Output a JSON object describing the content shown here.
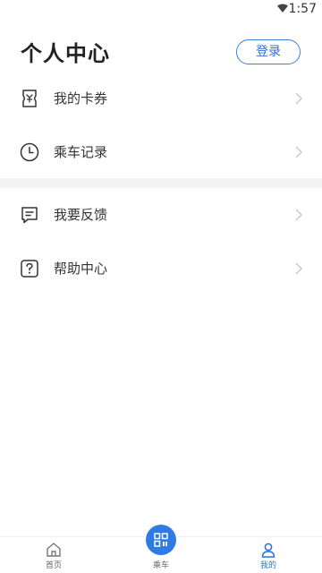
{
  "status_bar": {
    "time": "1:57",
    "wifi_icon": "wifi-icon"
  },
  "header": {
    "title": "个人中心",
    "login_label": "登录"
  },
  "menu": {
    "items": [
      {
        "label": "我的卡券",
        "icon": "ticket-icon"
      },
      {
        "label": "乘车记录",
        "icon": "clock-icon"
      },
      {
        "label": "我要反馈",
        "icon": "feedback-icon"
      },
      {
        "label": "帮助中心",
        "icon": "help-icon"
      }
    ]
  },
  "tab_bar": {
    "tabs": [
      {
        "label": "首页",
        "icon": "home-icon"
      },
      {
        "label": "乘车",
        "icon": "qr-code-icon"
      },
      {
        "label": "我的",
        "icon": "user-icon",
        "active": true
      }
    ]
  },
  "colors": {
    "accent": "#2f7be5",
    "text": "#333333",
    "divider": "#f3f4f6"
  }
}
